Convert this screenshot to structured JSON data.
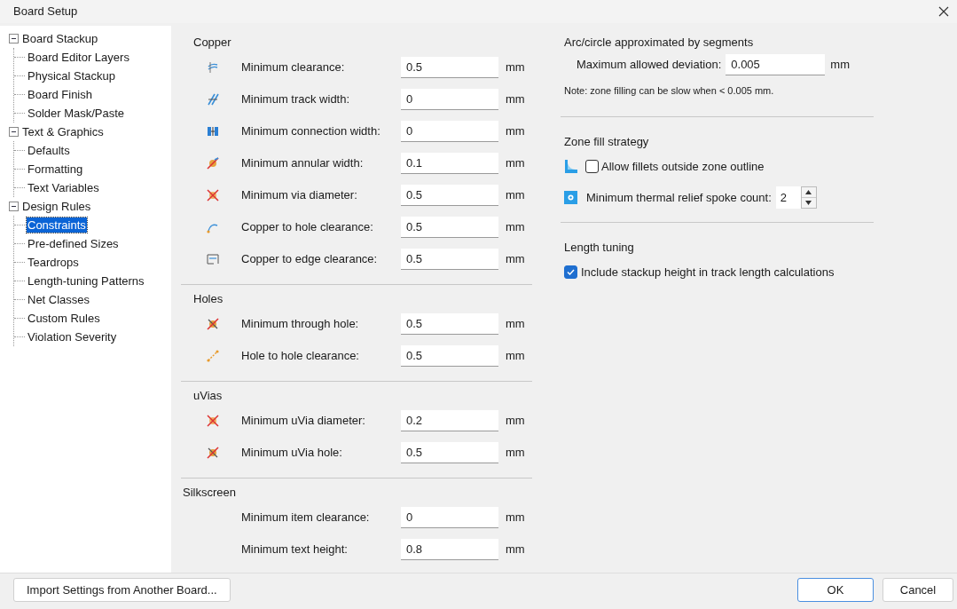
{
  "window": {
    "title": "Board Setup"
  },
  "sidebar": {
    "items": [
      {
        "label": "Board Stackup",
        "expanded": true,
        "selected": false,
        "children": [
          {
            "label": "Board Editor Layers",
            "selected": false
          },
          {
            "label": "Physical Stackup",
            "selected": false
          },
          {
            "label": "Board Finish",
            "selected": false
          },
          {
            "label": "Solder Mask/Paste",
            "selected": false
          }
        ]
      },
      {
        "label": "Text & Graphics",
        "expanded": true,
        "selected": false,
        "children": [
          {
            "label": "Defaults",
            "selected": false
          },
          {
            "label": "Formatting",
            "selected": false
          },
          {
            "label": "Text Variables",
            "selected": false
          }
        ]
      },
      {
        "label": "Design Rules",
        "expanded": true,
        "selected": false,
        "children": [
          {
            "label": "Constraints",
            "selected": true
          },
          {
            "label": "Pre-defined Sizes",
            "selected": false
          },
          {
            "label": "Teardrops",
            "selected": false
          },
          {
            "label": "Length-tuning Patterns",
            "selected": false
          },
          {
            "label": "Net Classes",
            "selected": false
          },
          {
            "label": "Custom Rules",
            "selected": false
          },
          {
            "label": "Violation Severity",
            "selected": false
          }
        ]
      }
    ]
  },
  "rules": {
    "sections": [
      {
        "title": "Copper",
        "rows": [
          {
            "label": "Minimum clearance:",
            "value": "0.5",
            "unit": "mm"
          },
          {
            "label": "Minimum track width:",
            "value": "0",
            "unit": "mm"
          },
          {
            "label": "Minimum connection width:",
            "value": "0",
            "unit": "mm"
          },
          {
            "label": "Minimum annular width:",
            "value": "0.1",
            "unit": "mm"
          },
          {
            "label": "Minimum via diameter:",
            "value": "0.5",
            "unit": "mm"
          },
          {
            "label": "Copper to hole clearance:",
            "value": "0.5",
            "unit": "mm"
          },
          {
            "label": "Copper to edge clearance:",
            "value": "0.5",
            "unit": "mm"
          }
        ]
      },
      {
        "title": "Holes",
        "rows": [
          {
            "label": "Minimum through hole:",
            "value": "0.5",
            "unit": "mm"
          },
          {
            "label": "Hole to hole clearance:",
            "value": "0.5",
            "unit": "mm"
          }
        ]
      },
      {
        "title": "uVias",
        "rows": [
          {
            "label": "Minimum uVia diameter:",
            "value": "0.2",
            "unit": "mm"
          },
          {
            "label": "Minimum uVia hole:",
            "value": "0.5",
            "unit": "mm"
          }
        ]
      },
      {
        "title": "Silkscreen",
        "rows": [
          {
            "label": "Minimum item clearance:",
            "value": "0",
            "unit": "mm"
          },
          {
            "label": "Minimum text height:",
            "value": "0.8",
            "unit": "mm"
          }
        ]
      }
    ]
  },
  "arc": {
    "title": "Arc/circle approximated by segments",
    "label": "Maximum allowed deviation:",
    "value": "0.005",
    "unit": "mm",
    "note": "Note: zone filling can be slow when < 0.005 mm."
  },
  "zone_fill": {
    "title": "Zone fill strategy",
    "fillets": {
      "label": "Allow fillets outside zone outline",
      "checked": false
    },
    "spokes": {
      "label": "Minimum thermal relief spoke count:",
      "value": "2"
    }
  },
  "length_tuning": {
    "title": "Length tuning",
    "stackup": {
      "label": "Include stackup height in track length calculations",
      "checked": true
    }
  },
  "buttons": {
    "import": "Import Settings from Another Board...",
    "ok": "OK",
    "cancel": "Cancel"
  }
}
